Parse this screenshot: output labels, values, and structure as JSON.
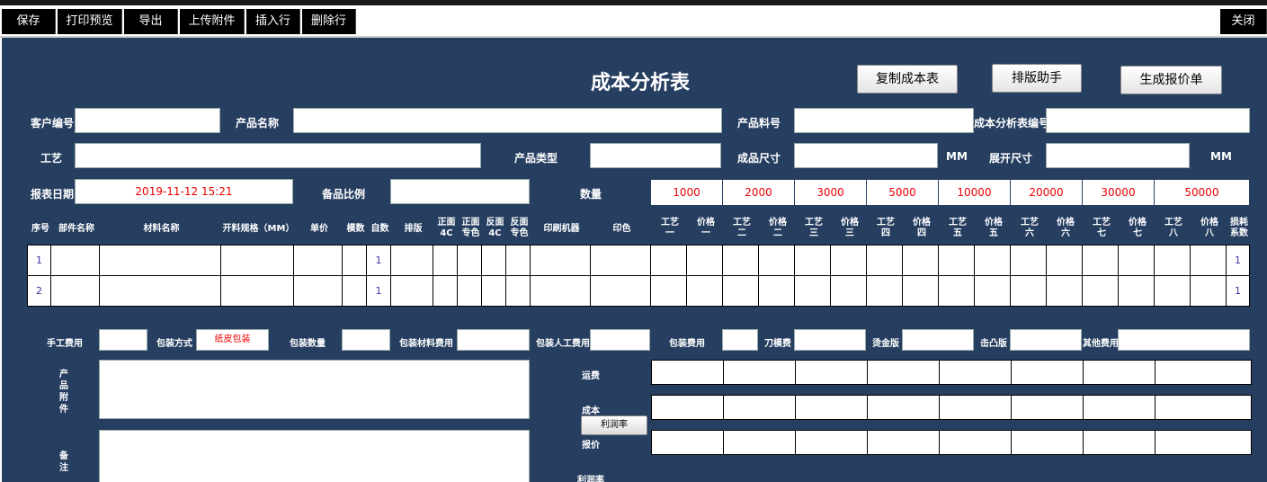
{
  "toolbar": {
    "save": "保存",
    "print_preview": "打印预览",
    "export": "导出",
    "upload_attachment": "上传附件",
    "insert_row": "插入行",
    "delete_row": "删除行",
    "close": "关闭"
  },
  "form": {
    "title": "成本分析表",
    "copy_cost_button": "复制成本表",
    "layout_helper_button": "排版助手",
    "generate_quote_button": "生成报价单",
    "customer_no_label": "客户编号",
    "customer_no_value": "",
    "product_name_label": "产品名称",
    "product_name_value": "",
    "product_part_no_label": "产品料号",
    "product_part_no_value": "",
    "cost_sheet_no_label": "成本分析表编号",
    "cost_sheet_no_value": "",
    "process_label": "工艺",
    "process_value": "",
    "product_type_label": "产品类型",
    "product_type_value": "",
    "finished_size_label": "成品尺寸",
    "finished_size_value": "",
    "finished_size_unit": "MM",
    "unfold_size_label": "展开尺寸",
    "unfold_size_value": "",
    "unfold_size_unit": "MM",
    "report_date_label": "报表日期",
    "report_date_value": "2019-11-12 15:21",
    "spare_ratio_label": "备品比例",
    "spare_ratio_value": "",
    "quantity_label": "数量",
    "quantities": [
      "1000",
      "2000",
      "3000",
      "5000",
      "10000",
      "20000",
      "30000",
      "50000"
    ]
  },
  "table": {
    "headers": {
      "seq": "序号",
      "part_name": "部件名称",
      "material_name": "材料名称",
      "cut_spec": "开料规格（MM）",
      "unit_price": "单价",
      "mold_count": "模数",
      "page_count": "自数",
      "layout": "排版",
      "front_4c_a": "正面",
      "front_4c_b": "4C",
      "front_spot_a": "正面",
      "front_spot_b": "专色",
      "back_4c_a": "反面",
      "back_4c_b": "4C",
      "back_spot_a": "反面",
      "back_spot_b": "专色",
      "press": "印刷机器",
      "print_color": "印色",
      "craft1_a": "工艺",
      "craft1_b": "一",
      "price1_a": "价格",
      "price1_b": "一",
      "craft2_a": "工艺",
      "craft2_b": "二",
      "price2_a": "价格",
      "price2_b": "二",
      "craft3_a": "工艺",
      "craft3_b": "三",
      "price3_a": "价格",
      "price3_b": "三",
      "craft4_a": "工艺",
      "craft4_b": "四",
      "price4_a": "价格",
      "price4_b": "四",
      "craft5_a": "工艺",
      "craft5_b": "五",
      "price5_a": "价格",
      "price5_b": "五",
      "craft6_a": "工艺",
      "craft6_b": "六",
      "price6_a": "价格",
      "price6_b": "六",
      "craft7_a": "工艺",
      "craft7_b": "七",
      "price7_a": "价格",
      "price7_b": "七",
      "craft8_a": "工艺",
      "craft8_b": "八",
      "price8_a": "价格",
      "price8_b": "八",
      "loss_a": "损耗",
      "loss_b": "系数"
    },
    "rows": [
      {
        "seq": "1",
        "page_count": "1",
        "loss": "1"
      },
      {
        "seq": "2",
        "page_count": "1",
        "loss": "1"
      }
    ]
  },
  "costs": {
    "manual_fee_label": "手工费用",
    "packing_method_label": "包装方式",
    "packing_method_value": "纸皮包装",
    "packing_qty_label": "包装数量",
    "packing_material_fee_label": "包装材料费用",
    "packing_labor_fee_label": "包装人工费用",
    "packing_fee_label": "包装费用",
    "knife_mold_fee_label": "刀模费",
    "hot_stamp_plate_label": "烫金版",
    "emboss_plate_label": "击凸版",
    "other_fee_label": "其他费用",
    "attachment_label": [
      "产",
      "品",
      "附",
      "件"
    ],
    "remark_label": [
      "备",
      "注"
    ],
    "freight_label": "运费",
    "cost_label": "成本",
    "profit_rate_button": "利润率",
    "quote_label": "报价",
    "profit_rate_label": "利润率"
  }
}
